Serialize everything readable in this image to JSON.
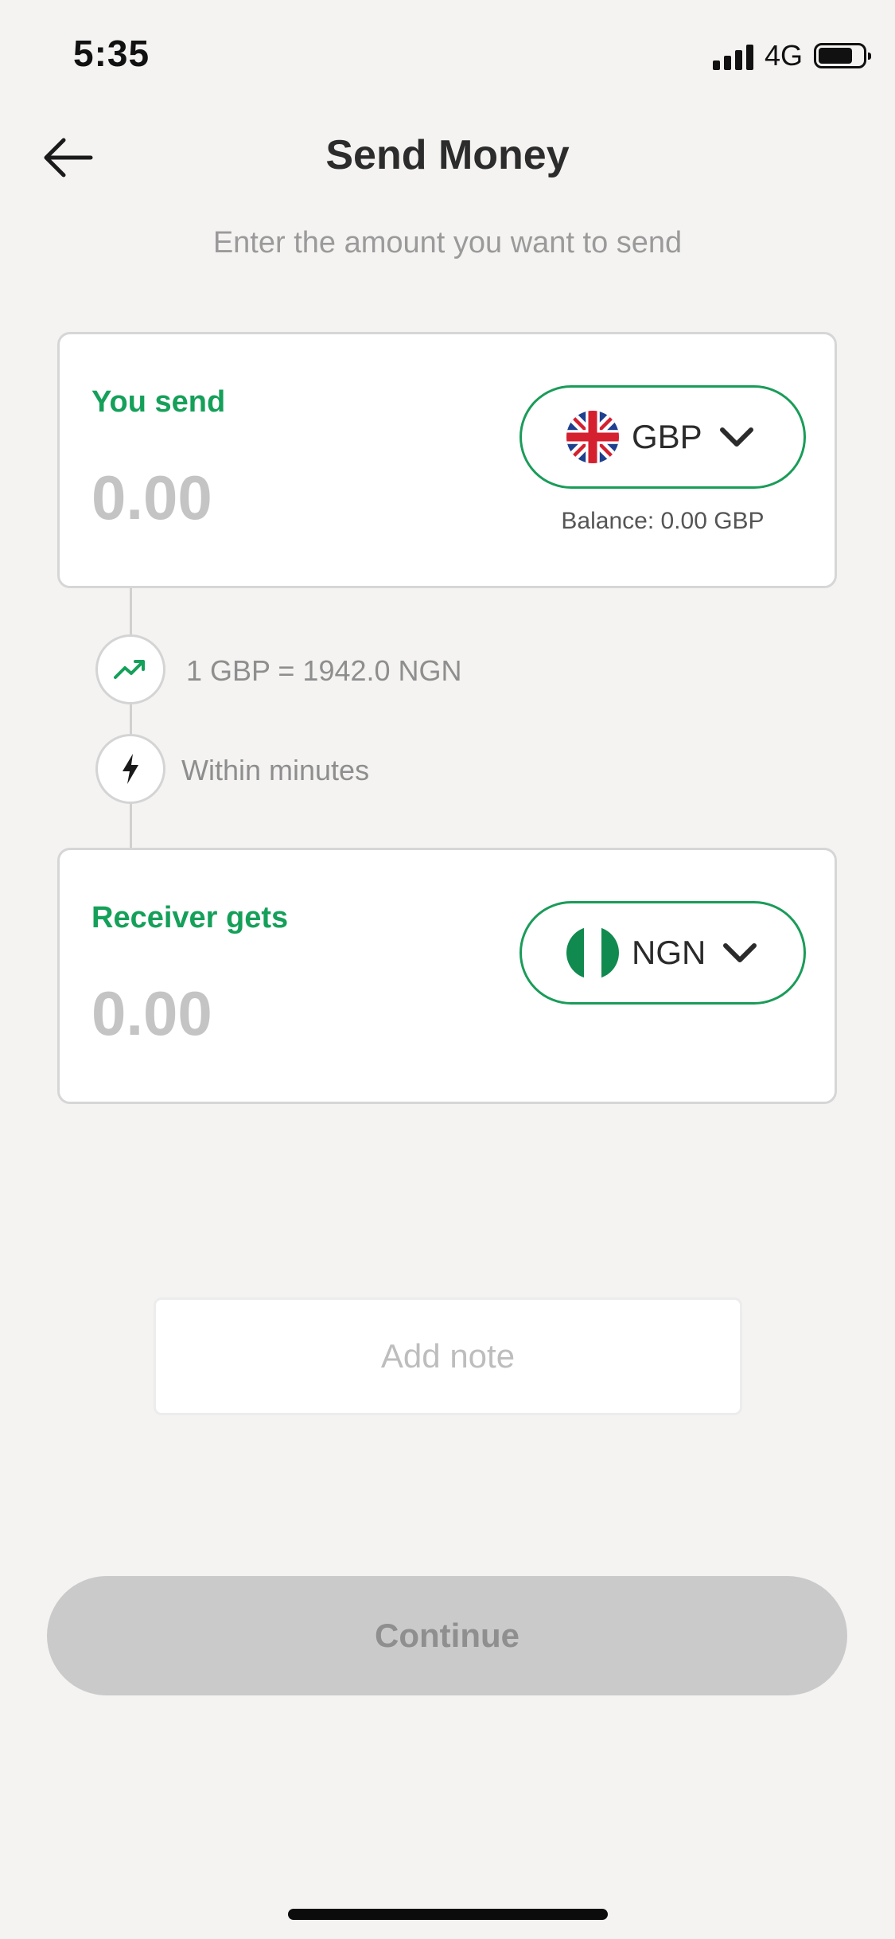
{
  "status_bar": {
    "time": "5:35",
    "network": "4G"
  },
  "header": {
    "title": "Send Money",
    "subtitle": "Enter the amount you want to send"
  },
  "send_card": {
    "label": "You send",
    "amount": "0.00",
    "currency": "GBP",
    "flag_icon": "uk-flag-icon",
    "balance": "Balance: 0.00 GBP"
  },
  "info": {
    "rate": "1 GBP = 1942.0 NGN",
    "speed": "Within minutes"
  },
  "receive_card": {
    "label": "Receiver gets",
    "amount": "0.00",
    "currency": "NGN",
    "flag_icon": "nigeria-flag-icon"
  },
  "note": {
    "placeholder": "Add note"
  },
  "continue_button": {
    "label": "Continue"
  },
  "colors": {
    "accent_green": "#15a05a",
    "pill_border": "#1a9c59",
    "disabled_button": "#cacaca",
    "background": "#f4f3f2"
  }
}
